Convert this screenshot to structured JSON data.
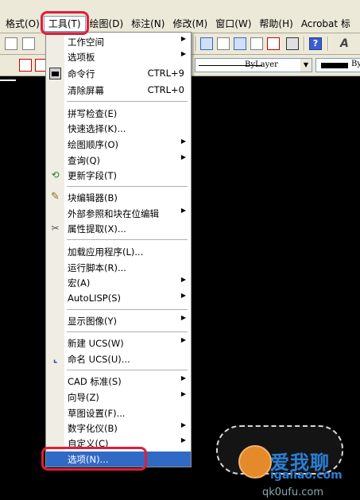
{
  "menubar": {
    "items": [
      "格式(O)",
      "工具(T)",
      "绘图(D)",
      "标注(N)",
      "修改(M)",
      "窗口(W)",
      "帮助(H)",
      "Acrobat 标"
    ]
  },
  "toolbar2": {
    "layer_text": "ByLayer",
    "color_text": "By"
  },
  "menu": {
    "items": [
      {
        "label": "工作空间"
      },
      {
        "label": "选项板"
      },
      {
        "label": "命令行",
        "shortcut": "CTRL+9"
      },
      {
        "label": "清除屏幕",
        "shortcut": "CTRL+0"
      },
      {
        "label": "拼写检查(E)"
      },
      {
        "label": "快速选择(K)..."
      },
      {
        "label": "绘图顺序(O)"
      },
      {
        "label": "查询(Q)"
      },
      {
        "label": "更新字段(T)"
      },
      {
        "label": "块编辑器(B)"
      },
      {
        "label": "外部参照和块在位编辑"
      },
      {
        "label": "属性提取(X)..."
      },
      {
        "label": "加载应用程序(L)..."
      },
      {
        "label": "运行脚本(R)..."
      },
      {
        "label": "宏(A)"
      },
      {
        "label": "AutoLISP(S)"
      },
      {
        "label": "显示图像(Y)"
      },
      {
        "label": "新建 UCS(W)"
      },
      {
        "label": "命名 UCS(U)..."
      },
      {
        "label": "CAD 标准(S)"
      },
      {
        "label": "向导(Z)"
      },
      {
        "label": "草图设置(F)..."
      },
      {
        "label": "数字化仪(B)"
      },
      {
        "label": "自定义(C)"
      },
      {
        "label": "选项(N)..."
      }
    ]
  },
  "watermark": {
    "brand": "爱我聊",
    "url": "igaliao.com",
    "url2": "qk0ufu.com"
  },
  "colors": {
    "highlight": "#316ac5",
    "ring": "#e01e3c"
  }
}
